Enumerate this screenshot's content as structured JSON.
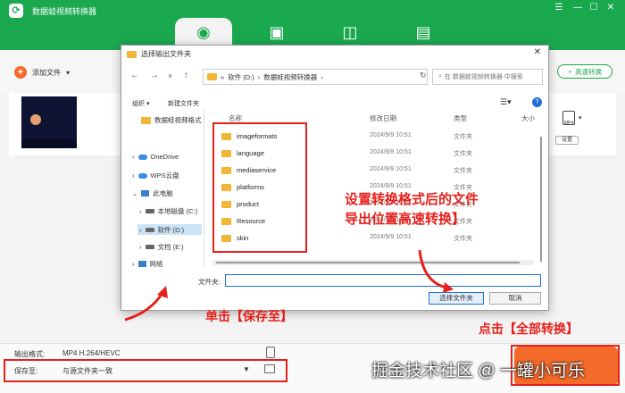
{
  "app": {
    "title": "数据蛙视频转换器",
    "window_controls": [
      "☰",
      "—",
      "☐",
      "✕"
    ]
  },
  "tabs": [
    {
      "name": "convert",
      "icon": "convert-icon",
      "active": true
    },
    {
      "name": "tv",
      "icon": "tv-icon",
      "active": false
    },
    {
      "name": "layout",
      "icon": "layout-icon",
      "active": false
    },
    {
      "name": "toolbox",
      "icon": "toolbox-icon",
      "active": false
    }
  ],
  "toolbar": {
    "add_file": "添加文件",
    "fast_convert": "高速转换"
  },
  "file_row": {
    "settings": "设置",
    "format_badge": "MP4"
  },
  "bottom": {
    "output_format_label": "输出格式:",
    "output_format_value": "MP4 H.264/HEVC",
    "save_to_label": "保存至:",
    "save_to_value": "与源文件夹一致"
  },
  "dialog": {
    "title": "选择输出文件夹",
    "close": "✕",
    "address": [
      "软件 (D:)",
      "数据蛙视频转换器"
    ],
    "search_placeholder": "在 数据蛙视频转换器 中搜索",
    "organize": "组织 ▾",
    "new_folder": "新建文件夹",
    "nav": [
      {
        "label": "数据蛙视频格式"
      },
      {
        "label": "OneDrive"
      },
      {
        "label": "WPS云盘"
      },
      {
        "label": "此电脑"
      },
      {
        "label": "本地磁盘 (C:)"
      },
      {
        "label": "软件 (D:)"
      },
      {
        "label": "文档 (E:)"
      },
      {
        "label": "网络"
      }
    ],
    "columns": {
      "name": "名称",
      "date": "修改日期",
      "type": "类型",
      "size": "大小"
    },
    "folders": [
      {
        "name": "imageformats",
        "date": "2024/9/9 10:51",
        "type": "文件夹"
      },
      {
        "name": "language",
        "date": "2024/9/9 10:51",
        "type": "文件夹"
      },
      {
        "name": "mediaservice",
        "date": "2024/9/9 10:51",
        "type": "文件夹"
      },
      {
        "name": "platforms",
        "date": "2024/9/9 10:51",
        "type": "文件夹"
      },
      {
        "name": "product",
        "date": "2024/9/9 10:51",
        "type": "文件夹"
      },
      {
        "name": "Resource",
        "date": "2024/9/9 10:51",
        "type": "文件夹"
      },
      {
        "name": "skin",
        "date": "2024/9/9 10:51",
        "type": "文件夹"
      }
    ],
    "folder_label": "文件夹:",
    "folder_value": "",
    "select_button": "选择文件夹",
    "cancel_button": "取消"
  },
  "callouts": {
    "tip_line1": "设置转换格式后的文件",
    "tip_line2": "导出位置高速转换】",
    "click_save": "单击【保存至】",
    "click_convert": "点击【全部转换】"
  },
  "watermark": "掘金技术社区 @ 一罐小可乐",
  "colors": {
    "brand": "#1aa84f",
    "accent": "#f36a2b",
    "annotation": "#e6201b"
  }
}
